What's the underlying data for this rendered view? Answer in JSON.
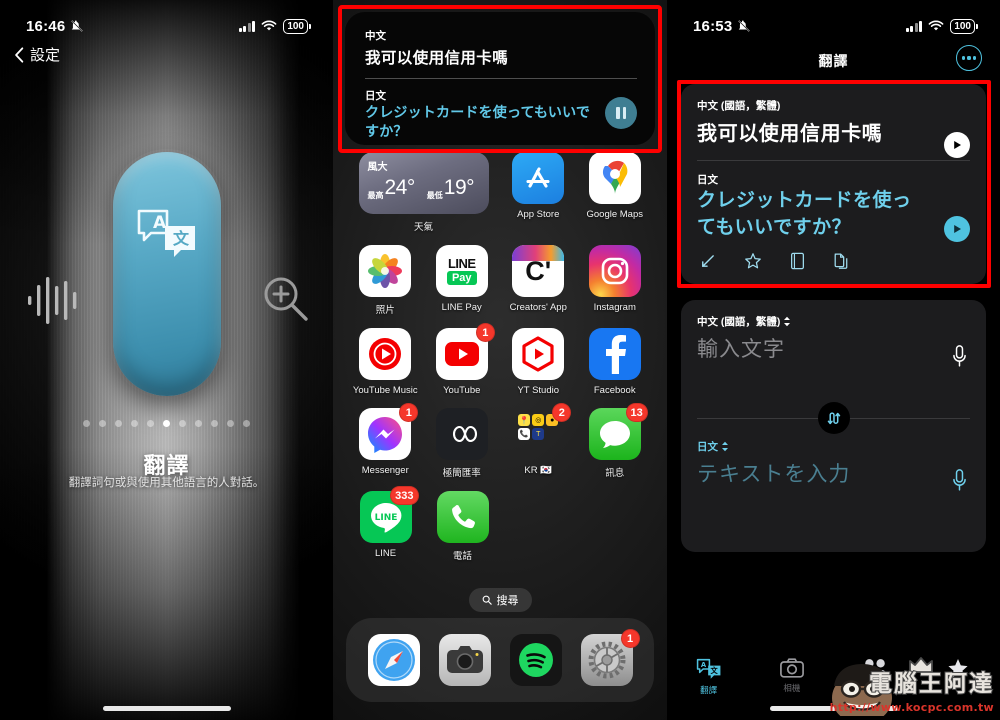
{
  "panel1": {
    "status": {
      "time": "16:46",
      "mute_icon": "bell-slash-icon",
      "signal": "signal-bars-icon",
      "wifi": "wifi-icon",
      "battery": "100"
    },
    "back_label": "設定",
    "app_icon": "translate-app-icon",
    "title": "翻譯",
    "subtitle": "翻譯詞句或與使用其他語言的人對話。",
    "page_dots_total": 11,
    "page_dot_active": 6,
    "waveform_icon": "audio-waveform-icon",
    "magnifier_icon": "magnifier-plus-icon"
  },
  "panel2": {
    "notification": {
      "source_lang": "中文",
      "source_text": "我可以使用信用卡嗎",
      "target_lang": "日文",
      "target_text": "クレジットカードを使ってもいいですか？",
      "pause_icon": "pause-button-icon"
    },
    "weather_widget": {
      "condition": "風大",
      "high_label": "最高",
      "high": "24°",
      "low_label": "最低",
      "low": "19°",
      "name": "天氣"
    },
    "rows": [
      [
        {
          "name": "weather-widget",
          "label": "天氣",
          "badge": ""
        },
        {
          "name": "app-store",
          "label": "App Store",
          "badge": ""
        },
        {
          "name": "google-maps",
          "label": "Google Maps",
          "badge": ""
        }
      ],
      [
        {
          "name": "photos",
          "label": "照片",
          "badge": ""
        },
        {
          "name": "line-pay",
          "label": "LINE Pay",
          "badge": ""
        },
        {
          "name": "creators-app",
          "label": "Creators' App",
          "badge": ""
        },
        {
          "name": "instagram",
          "label": "Instagram",
          "badge": ""
        }
      ],
      [
        {
          "name": "youtube-music",
          "label": "YouTube Music",
          "badge": ""
        },
        {
          "name": "youtube",
          "label": "YouTube",
          "badge": "1"
        },
        {
          "name": "yt-studio",
          "label": "YT Studio",
          "badge": ""
        },
        {
          "name": "facebook",
          "label": "Facebook",
          "badge": ""
        }
      ],
      [
        {
          "name": "messenger",
          "label": "Messenger",
          "badge": "1"
        },
        {
          "name": "currency-app",
          "label": "極簡匯率",
          "badge": ""
        },
        {
          "name": "kr-folder",
          "label": "KR 🇰🇷",
          "badge": "2"
        },
        {
          "name": "messages",
          "label": "訊息",
          "badge": "13"
        }
      ],
      [
        {
          "name": "line",
          "label": "LINE",
          "badge": "333"
        },
        {
          "name": "phone",
          "label": "電話",
          "badge": ""
        }
      ]
    ],
    "search_label": "搜尋",
    "search_icon": "search-icon",
    "dock": [
      {
        "name": "safari",
        "label": "Safari",
        "badge": ""
      },
      {
        "name": "camera",
        "label": "相機",
        "badge": ""
      },
      {
        "name": "spotify",
        "label": "Spotify",
        "badge": ""
      },
      {
        "name": "settings",
        "label": "設定",
        "badge": "1"
      }
    ]
  },
  "panel3": {
    "status": {
      "time": "16:53",
      "battery": "100"
    },
    "nav_title": "翻譯",
    "more_icon": "more-ellipsis-icon",
    "result": {
      "source_lang": "中文 (國語，繁體)",
      "source_text": "我可以使用信用卡嗎",
      "target_lang": "日文",
      "target_text": "クレジットカードを使ってもいいですか？",
      "play_source_icon": "play-button-icon",
      "play_target_icon": "play-button-icon",
      "actions": [
        {
          "name": "expand-fullscreen-icon"
        },
        {
          "name": "star-favorite-icon"
        },
        {
          "name": "dictionary-book-icon"
        },
        {
          "name": "copy-icon"
        }
      ]
    },
    "input": {
      "source_lang": "中文 (國語，繁體)",
      "source_placeholder": "輸入文字",
      "target_lang": "日文",
      "target_placeholder": "テキストを入力",
      "mic_icon": "microphone-icon",
      "swap_icon": "swap-languages-icon",
      "chevron_icon": "chevron-updown-icon"
    },
    "tabs": [
      {
        "name": "tab-translate",
        "label": "翻譯",
        "icon": "translate-icon",
        "active": true
      },
      {
        "name": "tab-camera",
        "label": "相機",
        "icon": "camera-icon",
        "active": false
      },
      {
        "name": "tab-conversation",
        "label": "",
        "icon": "people-icon",
        "active": false
      },
      {
        "name": "tab-favorites",
        "label": "",
        "icon": "star-icon",
        "active": false
      }
    ]
  },
  "watermark": {
    "brand": "電腦王阿達",
    "url": "http://www.kocpc.com.tw"
  },
  "colors": {
    "accent_cyan": "#4fc3e0",
    "badge_red": "#f5372b",
    "highlight_red": "#fe0000"
  }
}
